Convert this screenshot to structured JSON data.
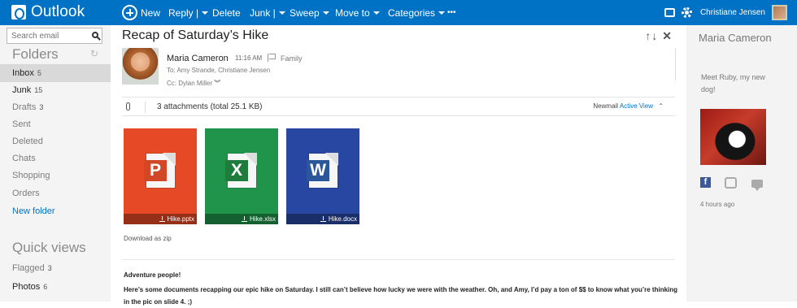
{
  "app": {
    "name": "Outlook"
  },
  "toolbar": {
    "new_label": "New",
    "reply_label": "Reply |",
    "delete_label": "Delete",
    "junk_label": "Junk |",
    "sweep_label": "Sweep",
    "moveto_label": "Move to",
    "categories_label": "Categories",
    "more_label": "•••"
  },
  "user": {
    "name": "Christiane Jensen"
  },
  "search": {
    "placeholder": "Search email"
  },
  "folders": {
    "title": "Folders",
    "items": [
      {
        "label": "Inbox",
        "count": "5",
        "active": true
      },
      {
        "label": "Junk",
        "count": "15"
      },
      {
        "label": "Drafts",
        "count": "3"
      },
      {
        "label": "Sent",
        "count": ""
      },
      {
        "label": "Deleted",
        "count": ""
      },
      {
        "label": "Chats",
        "count": ""
      },
      {
        "label": "Shopping",
        "count": ""
      },
      {
        "label": "Orders",
        "count": ""
      }
    ],
    "new_folder": "New folder"
  },
  "quickviews": {
    "title": "Quick views",
    "items": [
      {
        "label": "Flagged",
        "count": "3"
      },
      {
        "label": "Photos",
        "count": "6"
      }
    ]
  },
  "message": {
    "subject": "Recap of Saturday’s Hike",
    "actions": "↑↓ ✕",
    "from": "Maria Cameron",
    "time": "11:16 AM",
    "category": "Family",
    "to": "To:  Amy Strande, Christiane Jensen",
    "cc": "Cc:  Dylan Miller",
    "attachments_summary": "3 attachments (total 25.1 KB)",
    "newmail": "Newmail",
    "active_view": "Active View",
    "attachments": [
      {
        "name": "Hike.pptx",
        "letter": "P",
        "color": "#e64925"
      },
      {
        "name": "Hike.xlsx",
        "letter": "X",
        "color": "#20944a"
      },
      {
        "name": "Hike.docx",
        "letter": "W",
        "color": "#2847a2"
      }
    ],
    "download_zip": "Download as zip",
    "greeting": "Adventure people!",
    "body": "Here’s some documents recapping our epic hike on Saturday. I still can’t believe how lucky we were with the weather. Oh, and Amy, I’d pay a ton of $$ to know what you’re thinking in the pic on slide 4. ;)"
  },
  "contact": {
    "name": "Maria Cameron",
    "status": "Meet Ruby, my new dog!",
    "time": "4 hours ago",
    "facebook_label": "f"
  }
}
